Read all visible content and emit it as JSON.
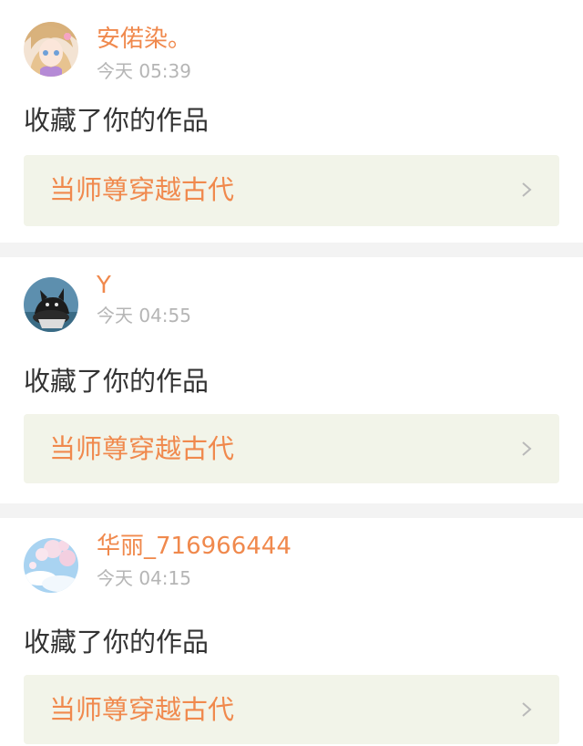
{
  "notifications": [
    {
      "username": "安偌染。",
      "time": "今天 05:39",
      "action": "收藏了你的作品",
      "work_title": "当师尊穿越古代",
      "avatar": "anime-girl-avatar"
    },
    {
      "username": "Y",
      "time": "今天 04:55",
      "action": "收藏了你的作品",
      "work_title": "当师尊穿越古代",
      "avatar": "black-cat-avatar"
    },
    {
      "username": "华丽_716966444",
      "time": "今天 04:15",
      "action": "收藏了你的作品",
      "work_title": "当师尊穿越古代",
      "avatar": "sky-blossom-avatar"
    }
  ],
  "colors": {
    "accent": "#f0894d",
    "link_background": "#f2f4e9",
    "timestamp": "#b5b5b5",
    "text": "#333333",
    "divider": "#f3f3f3"
  },
  "icons": {
    "chevron": "chevron-right-icon"
  }
}
